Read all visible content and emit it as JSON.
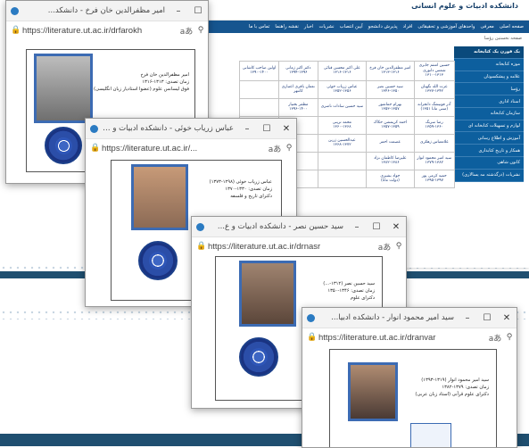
{
  "site": {
    "logo": "دانشکده ادبیات و علوم انسانی",
    "nav": [
      "صفحه اصلی",
      "معرفی",
      "واحدهای آموزشی و تحقیقاتی",
      "افراد",
      "پذیرش دانشجو",
      "آیین انتصاب",
      "نشریات",
      "اخبار",
      "نقشه راهنما",
      "تماس با ما"
    ],
    "breadcrumb": "صفحه نخستین رؤسا",
    "sidebar": [
      "بک فورن یک کتابخانه",
      "موزه کتابخانه",
      "علامه و پیشکسوتان",
      "رؤسا",
      "اسناد اداری",
      "سازمان کتابخانه",
      "لوازم و تسهیلات کتابخانه ای",
      "آموزش و اطلاع رسانی",
      "همکار و تاریخ کتابداری",
      "کانون شاهی",
      "نشریات (درگذشته مه یسالاری)"
    ],
    "grid": [
      [
        "اولین صاحب کاشانی\n۱۳۹۰-۱۴۰۰",
        "دکتر اکبر زمانی\n۱۳۹۴-۱۳۹۶",
        "علی اکبر محسن قبائی\n۱۳۱۶-۱۳۱۶",
        "امیر مظفرالدین خان فرخ\n۱۳۱۳-۱۳۱۶",
        "حسین امتثم جابری\nشمس دانوری\n۱۳۱۰-۱۳۱۳"
      ],
      [
        "",
        "نعمان باقری اعتباری\nکانتهر",
        "عباس زریاب خوئی\n۱۳۵۲-۱۳۵۶",
        "سید حسین نصر\n۱۳۴۶-۱۳۵۰",
        "عزت الله نگهبان\n۱۳۳۷-۱۳۴۲"
      ],
      [
        "",
        "مظفر بختیار\n۱۳۹۶-۱۴۰۰",
        "سید حسین سادات ناصری",
        "بهرام جماشور\n۱۳۵۳-۱۳۵۷",
        "آذر فوتیشگ دانجزانه\n(۱۳۵۱ منتی مانا)"
      ],
      [
        "",
        "",
        "محمد ترینی\n۱۳۶۰-۱۳۶۸",
        "احمد کریمشن حکاک\n۱۳۵۷-۱۳۵۹",
        "رضا سرنگ\n۱۳۵۹-۱۳۶۰"
      ],
      [
        "",
        "",
        "عبدالحسین زرین\n۱۳۶۸-۱۳۷۲",
        "عصمت احمر",
        "غلامعباس زهکری"
      ],
      [
        "",
        "",
        "",
        "علیرضا کاظمان نژاد\n۱۳۸۲-۱۳۸۶",
        "سید امیر محمود انوار\n۱۳۷۹-۱۳۸۲"
      ],
      [
        "",
        "",
        "",
        "جواد بشیری\n(دولت مانا)",
        "حمید کرمی پور\n۱۳۹۵-۱۳۹۷"
      ]
    ]
  },
  "windows": [
    {
      "title": "امیر مظفرالدین خان فرخ - دانشکد...",
      "url": "https://literature.ut.ac.ir/drfarokh",
      "info": [
        "امیر مظفرالدین خان فرخ",
        "زمان تصدی: ۱۳۱۳-۱۳۱۶",
        "فوق لیسانس علوم (عضوا استادیار زبان انگلیسی)"
      ]
    },
    {
      "title": "عباس زریاب خوئی - دانشکده ادبیات و علوم...",
      "url": "https://literature.ut.ac.ir/...",
      "info": [
        "عباس زریاب خوئی (۱۲۹۸-۱۳۷۳)",
        "زمان تصدی: ۱۳۳۰-۱۳۷۰",
        "دکترای تاریخ و فلسفه"
      ]
    },
    {
      "title": "سید حسین نصر - دانشکده ادبیات و ع...",
      "url": "https://literature.ut.ac.ir/drnasr",
      "info": [
        "سید حسین نصر (۱۳۱۲-...)",
        "زمان تصدی: ۱۳۴۶-۱۳۵۰",
        "دکترای علوم"
      ]
    },
    {
      "title": "سید امیر محمود انوار - دانشکده ادبیا...",
      "url": "https://literature.ut.ac.ir/dranvar",
      "info": [
        "سید امیر محمود انوار (۱۳۱۹-۱۳۹۳)",
        "زمان تصدی: ۱۳۷۹-۱۳۸۲",
        "دکترای علوم قرآنی (استاد زبان عربی)"
      ]
    }
  ],
  "controls": {
    "minimize": "–",
    "maximize": "☐",
    "close": "✕",
    "lock": "🔒",
    "read_aloud": "aあ",
    "zoom": "⚲"
  }
}
